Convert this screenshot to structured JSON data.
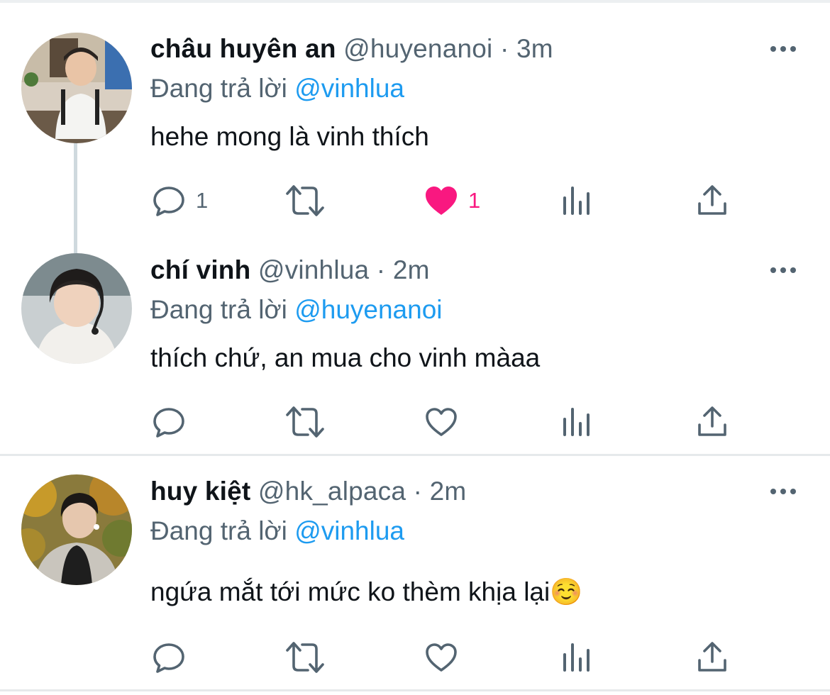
{
  "tweets": [
    {
      "name": "châu huyên an",
      "handle": "@huyenanoi",
      "dot": "·",
      "time": "3m",
      "reply_prefix": "Đang trả lời",
      "reply_to": "@vinhlua",
      "text": "hehe mong là vinh thích",
      "reply_count": "1",
      "like_count": "1",
      "liked": true
    },
    {
      "name": "chí vinh",
      "handle": "@vinhlua",
      "dot": "·",
      "time": "2m",
      "reply_prefix": "Đang trả lời",
      "reply_to": "@huyenanoi",
      "text": "thích chứ, an mua cho vinh màaa",
      "reply_count": "",
      "like_count": "",
      "liked": false
    },
    {
      "name": "huy kiệt",
      "handle": "@hk_alpaca",
      "dot": "·",
      "time": "2m",
      "reply_prefix": "Đang trả lời",
      "reply_to": "@vinhlua",
      "text": "ngứa mắt tới mức ko thèm khịa lại☺️",
      "reply_count": "",
      "like_count": "",
      "liked": false
    }
  ],
  "colors": {
    "accent": "#1d9bf0",
    "like": "#f91880",
    "muted": "#536471",
    "text": "#0f1419"
  },
  "icons": [
    "reply-icon",
    "retweet-icon",
    "like-icon",
    "analytics-icon",
    "share-icon",
    "more-icon"
  ]
}
